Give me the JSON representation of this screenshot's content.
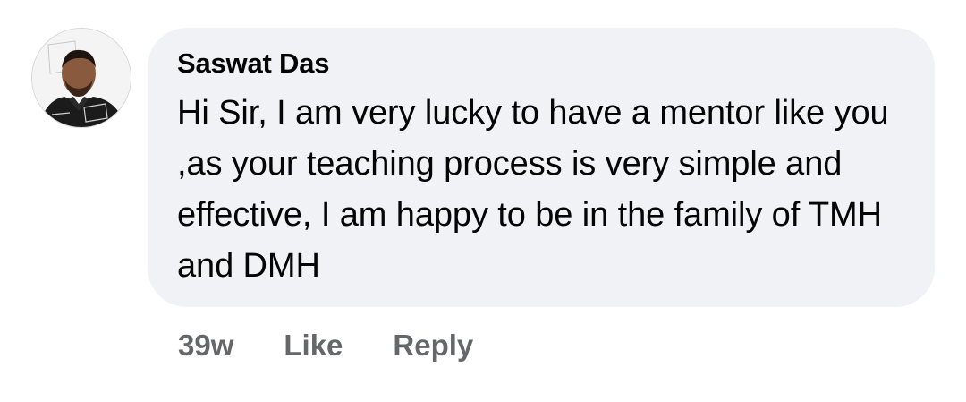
{
  "comment": {
    "author": "Saswat Das",
    "text": "Hi Sir, I am very lucky to have a mentor like you ,as your teaching process is very simple and effective, I am happy to be in the family of TMH and DMH",
    "timestamp": "39w",
    "like_label": "Like",
    "reply_label": "Reply"
  },
  "colors": {
    "bubble_background": "#f0f2f5",
    "author_text": "#050505",
    "body_text": "#050505",
    "action_text": "#65676b"
  },
  "icons": {
    "avatar": "profile-photo"
  }
}
